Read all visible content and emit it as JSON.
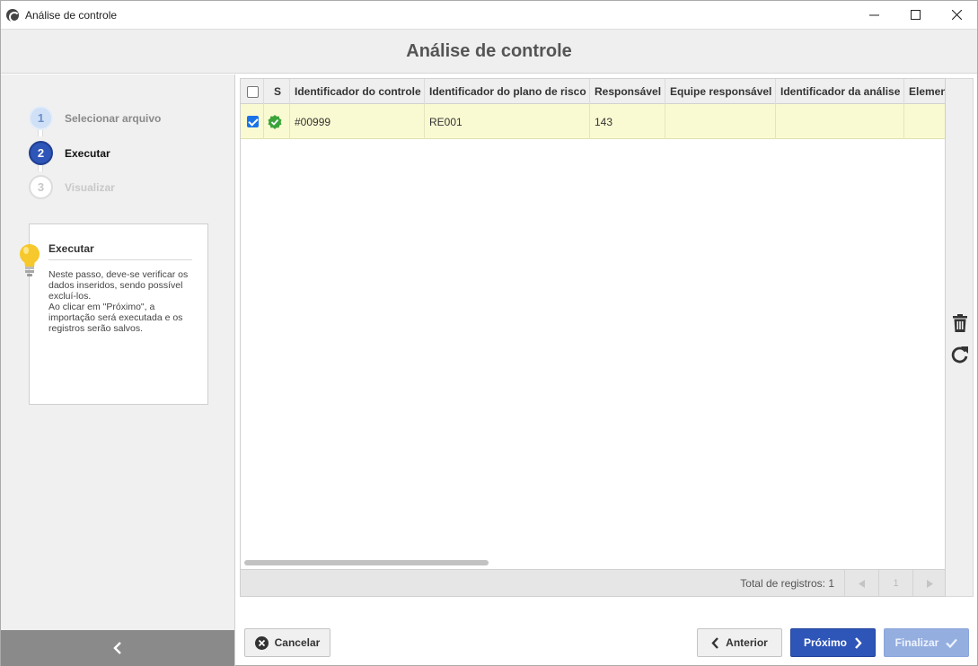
{
  "window": {
    "title": "Análise de controle"
  },
  "header": {
    "title": "Análise de controle"
  },
  "steps": [
    {
      "number": "1",
      "label": "Selecionar arquivo",
      "state": "done"
    },
    {
      "number": "2",
      "label": "Executar",
      "state": "active"
    },
    {
      "number": "3",
      "label": "Visualizar",
      "state": "todo"
    }
  ],
  "help": {
    "title": "Executar",
    "text": "Neste passo, deve-se verificar os dados inseridos, sendo possível excluí-los.\nAo clicar em \"Próximo\", a importação será executada e os registros serão salvos."
  },
  "grid": {
    "columns": [
      "",
      "S",
      "Identificador do controle",
      "Identificador do plano de risco",
      "Responsável",
      "Equipe responsável",
      "Identificador da análise",
      "Elemen"
    ],
    "rows": [
      {
        "checked": true,
        "status": "ok",
        "controle": "#00999",
        "plano": "RE001",
        "responsavel": "143",
        "equipe": "",
        "analise": "",
        "elemento": ""
      }
    ],
    "total": "Total de registros: 1",
    "page": "1"
  },
  "buttons": {
    "cancel": "Cancelar",
    "previous": "Anterior",
    "next": "Próximo",
    "finish": "Finalizar"
  },
  "colors": {
    "primary": "#2e55b8",
    "row_highlight": "#fafad2",
    "status_ok": "#3aa43a"
  }
}
